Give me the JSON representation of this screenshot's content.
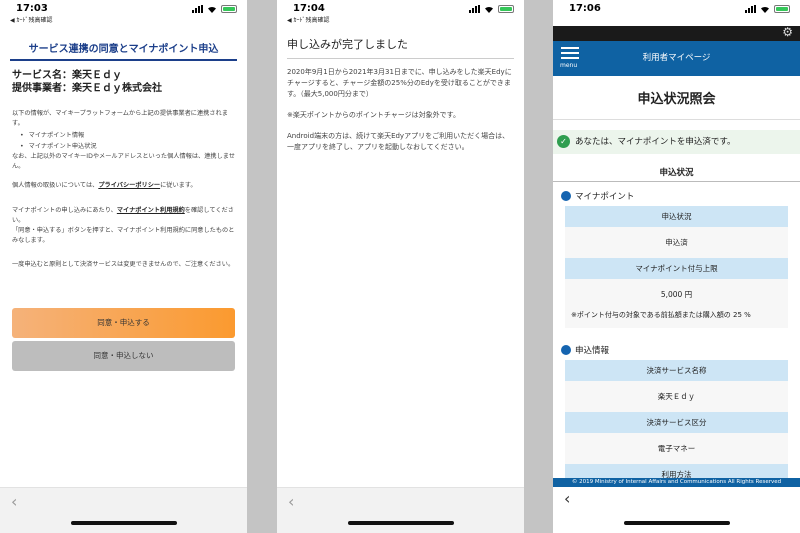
{
  "colors": {
    "accent": "#1c3f8a",
    "header_blue": "#0f62a3",
    "agree_orange": "#fb9a2f",
    "success_green": "#2e9e4f",
    "table_header": "#cde5f5"
  },
  "icons": {
    "back": "chevron-left-icon",
    "settings": "gear-icon",
    "menu": "hamburger-menu-icon",
    "check": "check-circle-icon"
  },
  "phone1": {
    "time": "17:03",
    "back_app": "◀ ｶｰﾄﾞ残高確認",
    "title": "サービス連携の同意とマイナポイント申込",
    "service_name": "サービス名：楽天Ｅｄｙ",
    "provider": "提供事業者：楽天Ｅｄｙ株式会社",
    "intro": "以下の情報が、マイキープラットフォームから上記の提供事業者に連携されます。",
    "list": [
      "マイナポイント情報",
      "マイナポイント申込状況"
    ],
    "note": "なお、上記以外のマイキーIDやメールアドレスといった個人情報は、連携しません。",
    "privacy_prefix": "個人情報の取扱いについては、",
    "privacy_link": "プライバシーポリシー",
    "privacy_suffix": "に従います。",
    "terms_prefix": "マイナポイントの申し込みにあたり、",
    "terms_link": "マイナポイント利用規約",
    "terms_suffix": "を確認してください。",
    "agree_note": "「同意・申込する」ボタンを押すと、マイナポイント利用規約に同意したものとみなします。",
    "warning": "一度申込むと原則として決済サービスは変更できませんので、ご注意ください。",
    "agree_button": "同意・申込する",
    "disagree_button": "同意・申込しない",
    "back_symbol": "‹"
  },
  "phone2": {
    "time": "17:04",
    "back_app": "◀ ｶｰﾄﾞ残高確認",
    "title": "申し込みが完了しました",
    "para1": "2020年9月1日から2021年3月31日までに、申し込みをした楽天Edyにチャージすると、チャージ金額の25%分のEdyを受け取ることができます。（最大5,000円分まで）",
    "para2": "※楽天ポイントからのポイントチャージは対象外です。",
    "para3": "Android端末の方は、続けて楽天Edyアプリをご利用いただく場合は、一度アプリを終了し、アプリを起動しなおしてください。",
    "back_symbol": "‹"
  },
  "phone3": {
    "time": "17:06",
    "settings_symbol": "⚙",
    "menu_label": "menu",
    "header_title": "利用者マイページ",
    "page_title": "申込状況照会",
    "alert": "あなたは、マイナポイントを申込済です。",
    "check_symbol": "✓",
    "section_title": "申込状況",
    "mynapoint": {
      "heading": "マイナポイント",
      "status_label": "申込状況",
      "status_value": "申込済",
      "limit_label": "マイナポイント付与上限",
      "limit_value": "5,000 円",
      "limit_note": "※ポイント付与の対象である前払額または購入額の 25 %"
    },
    "application": {
      "heading": "申込情報",
      "service_label": "決済サービス名称",
      "service_value": "楽天Ｅｄｙ",
      "category_label": "決済サービス区分",
      "category_value": "電子マネー",
      "method_label": "利用方法"
    },
    "footer": "© 2019 Ministry of Internal Affairs and Communications All Rights Reserved",
    "back_symbol": "‹"
  }
}
